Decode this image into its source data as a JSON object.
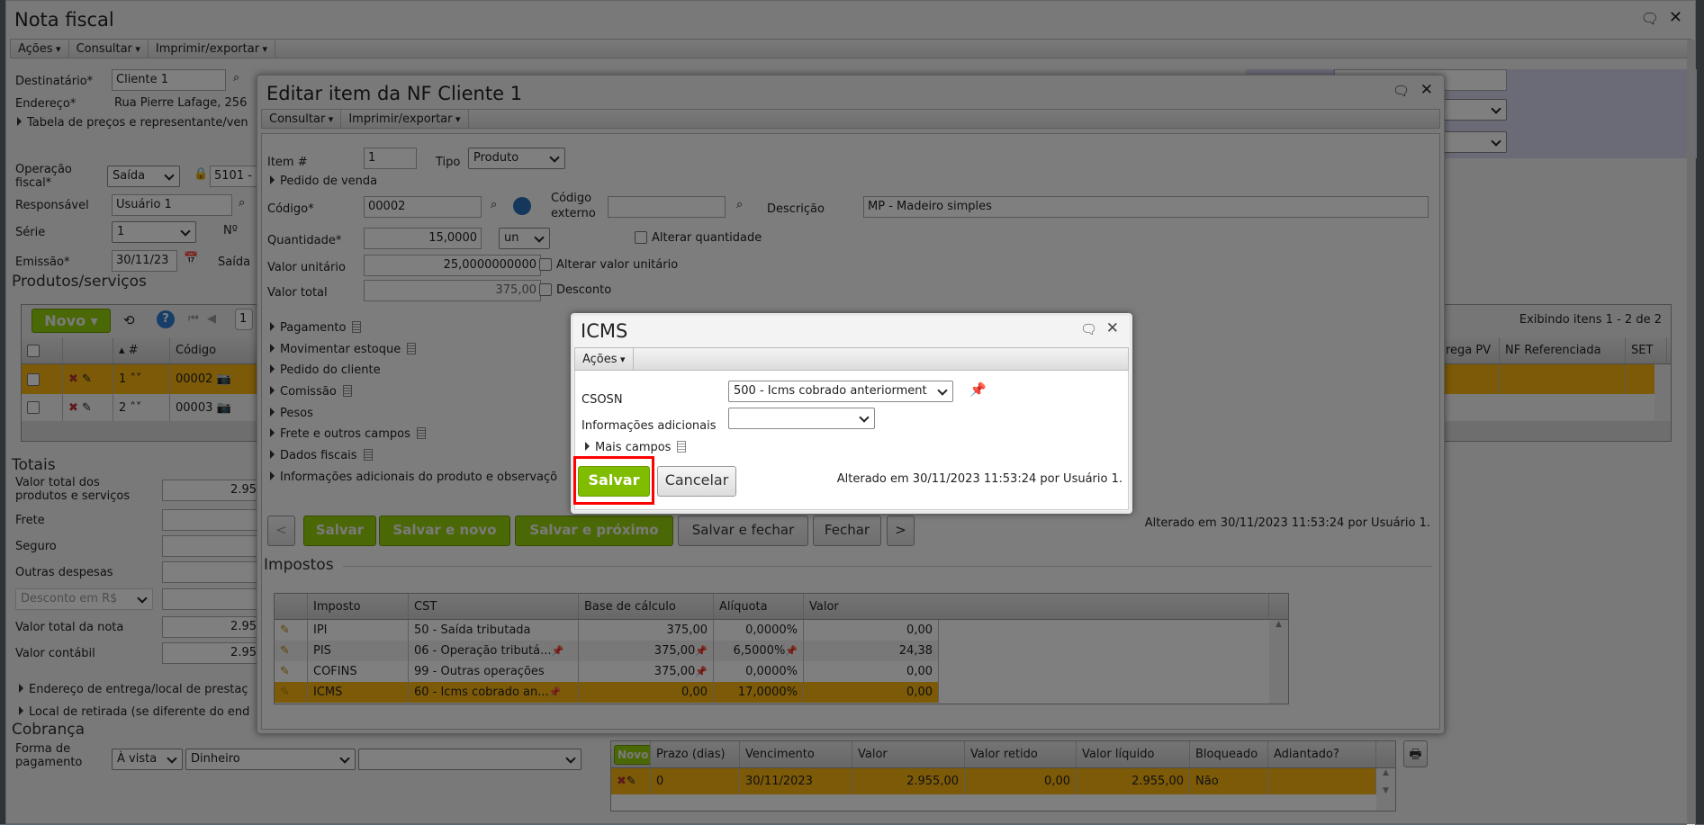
{
  "main": {
    "title": "Nota fiscal",
    "toolbar": [
      "Ações",
      "Consultar",
      "Imprimir/exportar"
    ],
    "destinatario_label": "Destinatário*",
    "destinatario": "Cliente 1",
    "endereco_label": "Endereço*",
    "endereco": "Rua Pierre Lafage, 256",
    "tabela": "Tabela de preços e representante/ven",
    "operacao_label1": "Operação",
    "operacao_label2": "fiscal*",
    "operacao": "Saída",
    "cfop": "5101 -",
    "responsavel_label": "Responsável",
    "responsavel": "Usuário 1",
    "serie_label": "Série",
    "serie": "1",
    "numero_label": "Nº",
    "emissao_label": "Emissão*",
    "emissao": "30/11/23",
    "saida_label": "Saída"
  },
  "produtos": {
    "title": "Produtos/serviços",
    "novo": "Novo",
    "page": "1",
    "exibindo": "Exibindo itens 1 - 2 de 2",
    "headers": {
      "num": "#",
      "codigo": "Código",
      "entrega": "rega PV",
      "nf_ref": "NF Referenciada",
      "set": "SET"
    },
    "rows": [
      {
        "num": "1",
        "codigo": "00002"
      },
      {
        "num": "2",
        "codigo": "00003"
      }
    ]
  },
  "totais": {
    "title": "Totais",
    "valor_total_1": "Valor total dos",
    "valor_total_2": "produtos e serviços",
    "valor_total": "2.95",
    "frete": "Frete",
    "seguro": "Seguro",
    "outras": "Outras despesas",
    "desconto": "Desconto em R$",
    "valor_nota_label": "Valor total da nota",
    "valor_nota": "2.95",
    "contabil_label": "Valor contábil",
    "contabil": "2.95",
    "entrega": "Endereço de entrega/local de prestaç",
    "retirada": "Local de retirada (se diferente do end"
  },
  "cobranca": {
    "title": "Cobrança",
    "forma_1": "Forma de",
    "forma_2": "pagamento",
    "condicao": "À vista",
    "meio": "Dinheiro",
    "extra": "",
    "novo": "Novo",
    "headers": [
      "Prazo (dias)",
      "Vencimento",
      "Valor",
      "Valor retido",
      "Valor líquido",
      "Bloqueado",
      "Adiantado?"
    ],
    "rows": [
      [
        "0",
        "30/11/2023",
        "2.955,00",
        "0,00",
        "2.955,00",
        "Não",
        ""
      ]
    ]
  },
  "edit": {
    "title": "Editar item da NF Cliente 1",
    "toolbar": [
      "Consultar",
      "Imprimir/exportar"
    ],
    "item_label": "Item #",
    "item": "1",
    "tipo_label": "Tipo",
    "tipo": "Produto",
    "pedido_venda": "Pedido de venda",
    "codigo_label": "Código*",
    "codigo": "00002",
    "cod_ext_1": "Código",
    "cod_ext_2": "externo",
    "cod_ext": "",
    "descricao_label": "Descrição",
    "descricao": "MP - Madeiro simples",
    "qtd_label": "Quantidade*",
    "qtd": "15,0000",
    "unidade": "un",
    "alterar_qtd": "Alterar quantidade",
    "vu_label": "Valor unitário",
    "vu": "25,0000000000",
    "alterar_vu": "Alterar valor unitário",
    "vt_label": "Valor total",
    "vt": "375,00",
    "desconto": "Desconto",
    "sections": [
      "Pagamento",
      "Movimentar estoque",
      "Pedido do cliente",
      "Comissão",
      "Pesos",
      "Frete e outros campos",
      "Dados fiscais",
      "Informações adicionais do produto e observaçõ"
    ],
    "buttons": {
      "prev": "<",
      "salvar": "Salvar",
      "salvar_novo": "Salvar e novo",
      "salvar_proximo": "Salvar e próximo",
      "salvar_fechar": "Salvar e fechar",
      "fechar": "Fechar",
      "next": ">"
    },
    "alterado": "Alterado em 30/11/2023 11:53:24 por Usuário 1.",
    "impostos": {
      "title": "Impostos",
      "headers": [
        "Imposto",
        "CST",
        "Base de cálculo",
        "Alíquota",
        "Valor"
      ],
      "rows": [
        [
          "IPI",
          "50 - Saída tributada",
          "375,00",
          "0,0000%",
          "0,00"
        ],
        [
          "PIS",
          "06 - Operação tributá...",
          "375,00",
          "6,5000%",
          "24,38"
        ],
        [
          "COFINS",
          "99 - Outras operações",
          "375,00",
          "0,0000%",
          "0,00"
        ],
        [
          "ICMS",
          "60 - Icms cobrado an...",
          "0,00",
          "17,0000%",
          "0,00"
        ]
      ]
    }
  },
  "icms": {
    "title": "ICMS",
    "toolbar": "Ações",
    "csosn_label": "CSOSN",
    "csosn": "500 - Icms cobrado anteriorment",
    "info_label": "Informações adicionais",
    "info": "",
    "mais_campos": "Mais campos",
    "salvar": "Salvar",
    "cancelar": "Cancelar",
    "alterado": "Alterado em 30/11/2023 11:53:24 por Usuário 1."
  },
  "colors": {
    "accent_green": "#96d00e",
    "selected_row": "#f8b40f",
    "highlight": "#ff0000"
  }
}
